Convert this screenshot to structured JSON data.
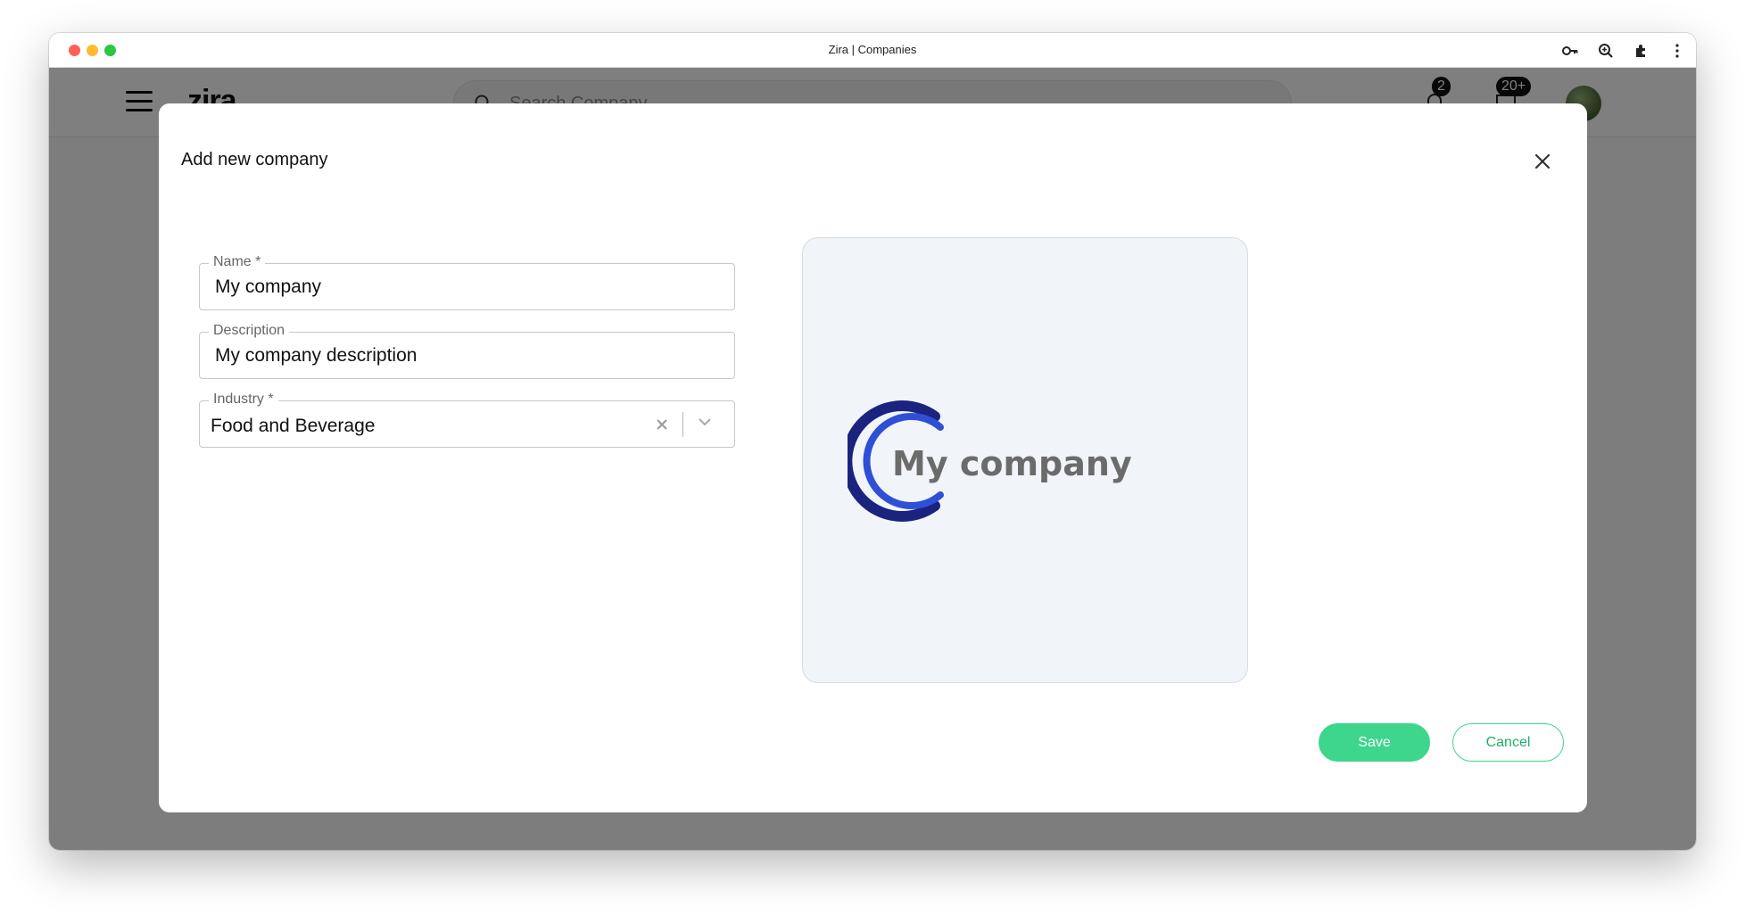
{
  "window": {
    "title": "Zira | Companies"
  },
  "app": {
    "brand": "zira",
    "search": {
      "placeholder": "Search Company",
      "value": ""
    },
    "notifications": {
      "badge": "2"
    },
    "messages": {
      "badge": "20+"
    }
  },
  "modal": {
    "title": "Add new company",
    "fields": {
      "name": {
        "label": "Name *",
        "value": "My company"
      },
      "description": {
        "label": "Description",
        "value": "My company description"
      },
      "industry": {
        "label": "Industry *",
        "value": "Food and Beverage"
      }
    },
    "logo": {
      "text": "My company"
    },
    "buttons": {
      "save": "Save",
      "cancel": "Cancel"
    }
  },
  "colors": {
    "accent": "#3dd68c",
    "logo_dark_blue": "#1a237e",
    "logo_blue": "#2f4fd6",
    "logo_text": "#6b6b6b"
  }
}
